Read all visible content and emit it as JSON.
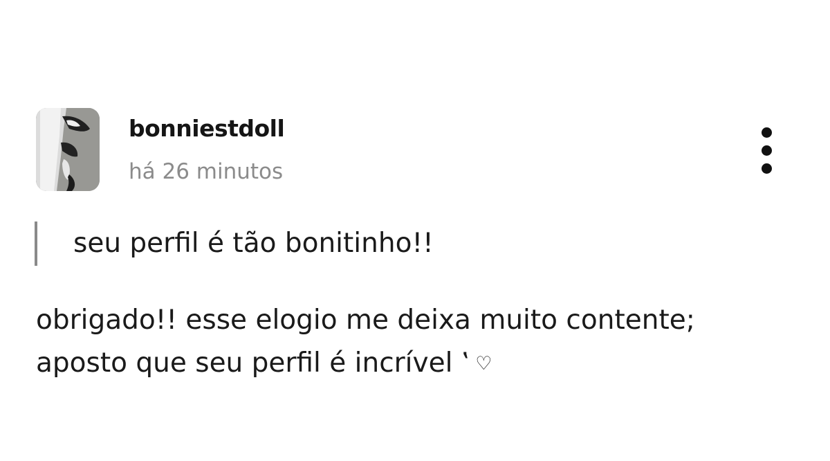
{
  "post": {
    "author": {
      "username": "bonniestdoll",
      "time_ago": "há 26 minutos"
    },
    "quoted_message": "seu perfil é tão bonitinho!!",
    "reply": {
      "line1": "obrigado!! esse elogio me deixa muito contente;",
      "line2": "aposto que seu perfil é incrível ‛",
      "emoji": "♡"
    },
    "more_options_icon": "vertical-ellipsis-icon"
  },
  "colors": {
    "text": "#1a1a1a",
    "timestamp": "#8b8b8b",
    "quote_bar": "#8a8a8a",
    "background": "#ffffff"
  }
}
